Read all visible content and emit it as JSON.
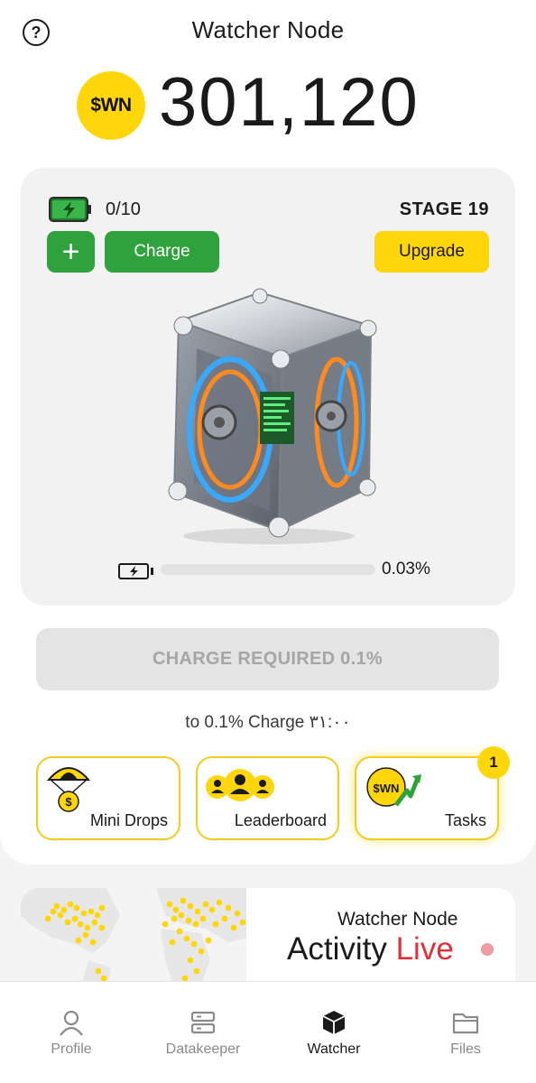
{
  "header": {
    "title": "Watcher Node",
    "help_icon": "question-circle-icon",
    "coin_label": "$WN",
    "balance": "301,120"
  },
  "node": {
    "charge_count": "0/10",
    "stage": "STAGE 19",
    "plus_label": "+",
    "charge_label": "Charge",
    "upgrade_label": "Upgrade",
    "charge_progress_percent": 0.03,
    "charge_progress_label": "0.03%",
    "image": "watcher-node-cube"
  },
  "charge_required_label": "CHARGE REQUIRED 0.1%",
  "charge_timer": "to 0.1% Charge ۳۱:۰۰",
  "features": [
    {
      "label": "Mini Drops",
      "icon": "parachute-coin-icon"
    },
    {
      "label": "Leaderboard",
      "icon": "users-group-icon"
    },
    {
      "label": "Tasks",
      "icon": "wn-coin-arrow-icon",
      "badge": "1",
      "coin_label": "$WN"
    }
  ],
  "activity": {
    "title": "Watcher Node",
    "heading": "Activity",
    "live": "Live"
  },
  "bottom_nav": [
    {
      "label": "Profile",
      "icon": "user-icon",
      "active": false
    },
    {
      "label": "Datakeeper",
      "icon": "server-icon",
      "active": false
    },
    {
      "label": "Watcher",
      "icon": "cube-icon",
      "active": true
    },
    {
      "label": "Files",
      "icon": "folder-icon",
      "active": false
    }
  ],
  "colors": {
    "accent_yellow": "#ffd60a",
    "accent_green": "#2fa23d",
    "live_red": "#e0303a"
  }
}
